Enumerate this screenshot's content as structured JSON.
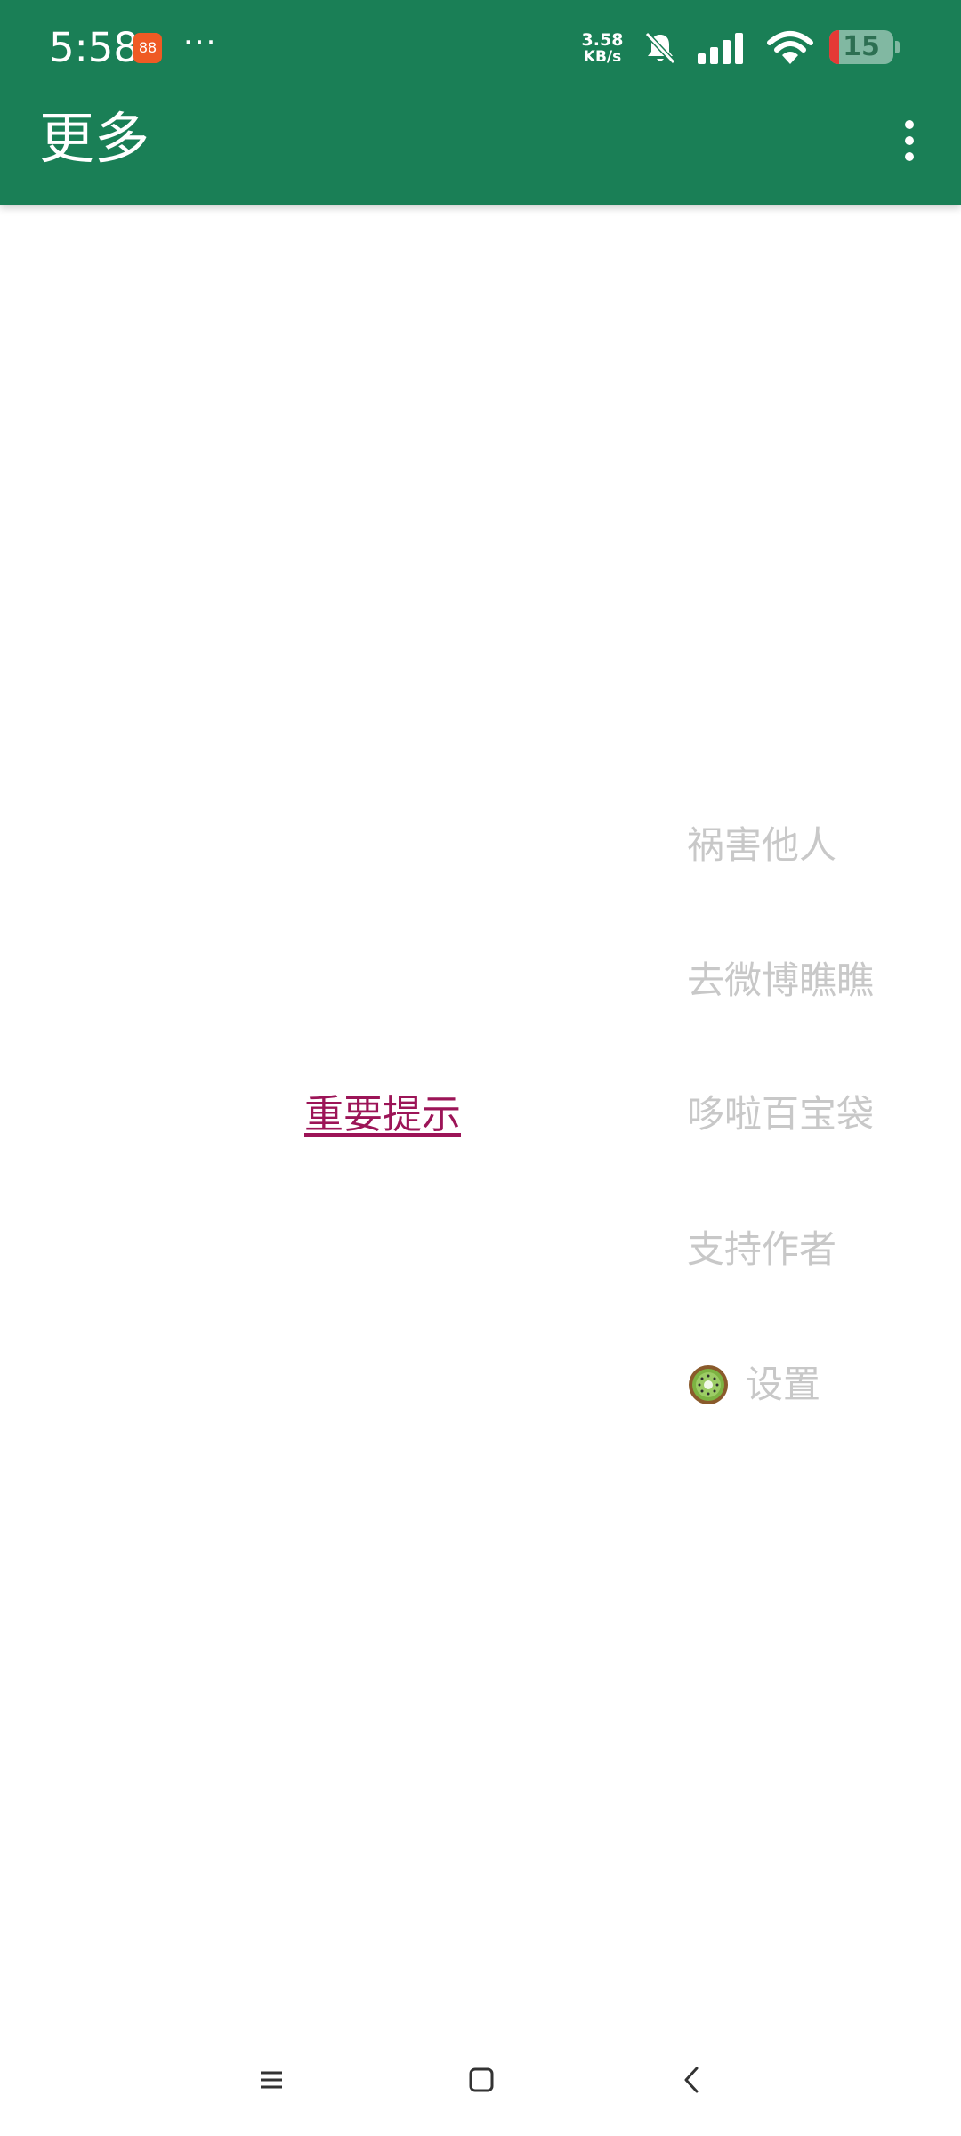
{
  "status_bar": {
    "time": "5:58",
    "app_badge_text": "88",
    "overflow_dots": "···",
    "network_speed_value": "3.58",
    "network_speed_unit": "KB/s",
    "battery_level": "15"
  },
  "toolbar": {
    "title": "更多"
  },
  "main": {
    "notice_link": "重要提示"
  },
  "menu": {
    "items": [
      {
        "label": "祸害他人"
      },
      {
        "label": "去微博瞧瞧"
      },
      {
        "label": "哆啦百宝袋"
      },
      {
        "label": "支持作者"
      },
      {
        "label": "设置",
        "icon": "kiwi-icon"
      }
    ]
  },
  "colors": {
    "toolbar_bg": "#1a7f56",
    "notice_link": "#9c1457",
    "menu_text": "#c8c8c8",
    "battery_low": "#e53935"
  }
}
